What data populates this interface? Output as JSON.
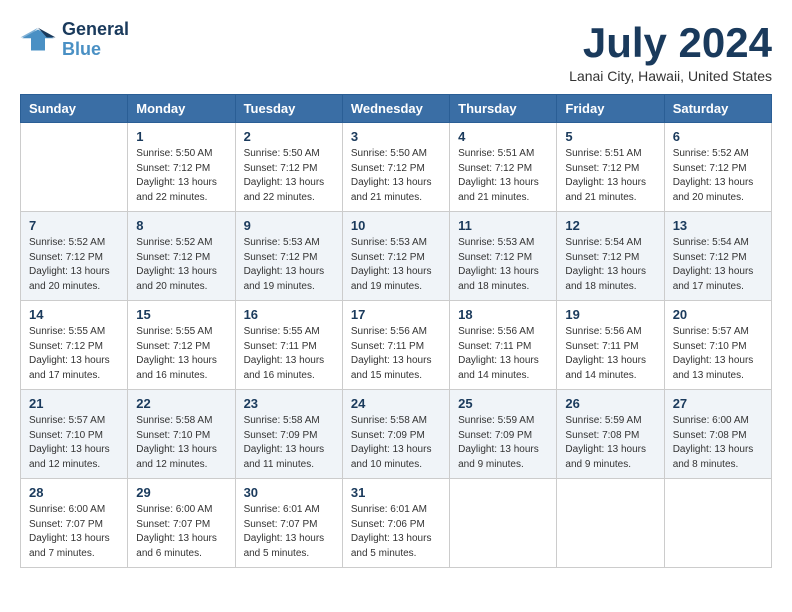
{
  "header": {
    "logo_line1": "General",
    "logo_line2": "Blue",
    "month_title": "July 2024",
    "location": "Lanai City, Hawaii, United States"
  },
  "weekdays": [
    "Sunday",
    "Monday",
    "Tuesday",
    "Wednesday",
    "Thursday",
    "Friday",
    "Saturday"
  ],
  "weeks": [
    [
      {
        "day": "",
        "info": ""
      },
      {
        "day": "1",
        "info": "Sunrise: 5:50 AM\nSunset: 7:12 PM\nDaylight: 13 hours\nand 22 minutes."
      },
      {
        "day": "2",
        "info": "Sunrise: 5:50 AM\nSunset: 7:12 PM\nDaylight: 13 hours\nand 22 minutes."
      },
      {
        "day": "3",
        "info": "Sunrise: 5:50 AM\nSunset: 7:12 PM\nDaylight: 13 hours\nand 21 minutes."
      },
      {
        "day": "4",
        "info": "Sunrise: 5:51 AM\nSunset: 7:12 PM\nDaylight: 13 hours\nand 21 minutes."
      },
      {
        "day": "5",
        "info": "Sunrise: 5:51 AM\nSunset: 7:12 PM\nDaylight: 13 hours\nand 21 minutes."
      },
      {
        "day": "6",
        "info": "Sunrise: 5:52 AM\nSunset: 7:12 PM\nDaylight: 13 hours\nand 20 minutes."
      }
    ],
    [
      {
        "day": "7",
        "info": "Sunrise: 5:52 AM\nSunset: 7:12 PM\nDaylight: 13 hours\nand 20 minutes."
      },
      {
        "day": "8",
        "info": "Sunrise: 5:52 AM\nSunset: 7:12 PM\nDaylight: 13 hours\nand 20 minutes."
      },
      {
        "day": "9",
        "info": "Sunrise: 5:53 AM\nSunset: 7:12 PM\nDaylight: 13 hours\nand 19 minutes."
      },
      {
        "day": "10",
        "info": "Sunrise: 5:53 AM\nSunset: 7:12 PM\nDaylight: 13 hours\nand 19 minutes."
      },
      {
        "day": "11",
        "info": "Sunrise: 5:53 AM\nSunset: 7:12 PM\nDaylight: 13 hours\nand 18 minutes."
      },
      {
        "day": "12",
        "info": "Sunrise: 5:54 AM\nSunset: 7:12 PM\nDaylight: 13 hours\nand 18 minutes."
      },
      {
        "day": "13",
        "info": "Sunrise: 5:54 AM\nSunset: 7:12 PM\nDaylight: 13 hours\nand 17 minutes."
      }
    ],
    [
      {
        "day": "14",
        "info": "Sunrise: 5:55 AM\nSunset: 7:12 PM\nDaylight: 13 hours\nand 17 minutes."
      },
      {
        "day": "15",
        "info": "Sunrise: 5:55 AM\nSunset: 7:12 PM\nDaylight: 13 hours\nand 16 minutes."
      },
      {
        "day": "16",
        "info": "Sunrise: 5:55 AM\nSunset: 7:11 PM\nDaylight: 13 hours\nand 16 minutes."
      },
      {
        "day": "17",
        "info": "Sunrise: 5:56 AM\nSunset: 7:11 PM\nDaylight: 13 hours\nand 15 minutes."
      },
      {
        "day": "18",
        "info": "Sunrise: 5:56 AM\nSunset: 7:11 PM\nDaylight: 13 hours\nand 14 minutes."
      },
      {
        "day": "19",
        "info": "Sunrise: 5:56 AM\nSunset: 7:11 PM\nDaylight: 13 hours\nand 14 minutes."
      },
      {
        "day": "20",
        "info": "Sunrise: 5:57 AM\nSunset: 7:10 PM\nDaylight: 13 hours\nand 13 minutes."
      }
    ],
    [
      {
        "day": "21",
        "info": "Sunrise: 5:57 AM\nSunset: 7:10 PM\nDaylight: 13 hours\nand 12 minutes."
      },
      {
        "day": "22",
        "info": "Sunrise: 5:58 AM\nSunset: 7:10 PM\nDaylight: 13 hours\nand 12 minutes."
      },
      {
        "day": "23",
        "info": "Sunrise: 5:58 AM\nSunset: 7:09 PM\nDaylight: 13 hours\nand 11 minutes."
      },
      {
        "day": "24",
        "info": "Sunrise: 5:58 AM\nSunset: 7:09 PM\nDaylight: 13 hours\nand 10 minutes."
      },
      {
        "day": "25",
        "info": "Sunrise: 5:59 AM\nSunset: 7:09 PM\nDaylight: 13 hours\nand 9 minutes."
      },
      {
        "day": "26",
        "info": "Sunrise: 5:59 AM\nSunset: 7:08 PM\nDaylight: 13 hours\nand 9 minutes."
      },
      {
        "day": "27",
        "info": "Sunrise: 6:00 AM\nSunset: 7:08 PM\nDaylight: 13 hours\nand 8 minutes."
      }
    ],
    [
      {
        "day": "28",
        "info": "Sunrise: 6:00 AM\nSunset: 7:07 PM\nDaylight: 13 hours\nand 7 minutes."
      },
      {
        "day": "29",
        "info": "Sunrise: 6:00 AM\nSunset: 7:07 PM\nDaylight: 13 hours\nand 6 minutes."
      },
      {
        "day": "30",
        "info": "Sunrise: 6:01 AM\nSunset: 7:07 PM\nDaylight: 13 hours\nand 5 minutes."
      },
      {
        "day": "31",
        "info": "Sunrise: 6:01 AM\nSunset: 7:06 PM\nDaylight: 13 hours\nand 5 minutes."
      },
      {
        "day": "",
        "info": ""
      },
      {
        "day": "",
        "info": ""
      },
      {
        "day": "",
        "info": ""
      }
    ]
  ]
}
